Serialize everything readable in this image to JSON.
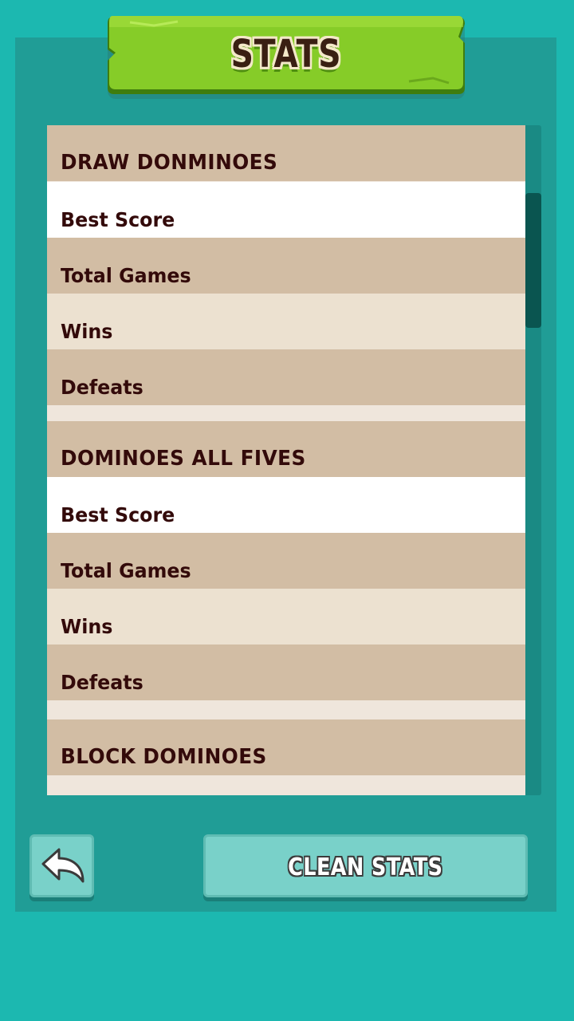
{
  "title": "STATS",
  "colors": {
    "background": "#1cb8b0",
    "panel": "#209d96",
    "banner_green": "#86cc28",
    "header_row": "#d2bda4",
    "text": "#330a0a"
  },
  "sections": [
    {
      "title": "DRAW DONMINOES",
      "rows": [
        "Best Score",
        "Total Games",
        "Wins",
        "Defeats"
      ]
    },
    {
      "title": "DOMINOES ALL FIVES",
      "rows": [
        "Best Score",
        "Total Games",
        "Wins",
        "Defeats"
      ]
    },
    {
      "title": "BLOCK DOMINOES",
      "rows": []
    }
  ],
  "buttons": {
    "back_icon": "back-arrow-icon",
    "clean_stats_label": "CLEAN STATS"
  }
}
